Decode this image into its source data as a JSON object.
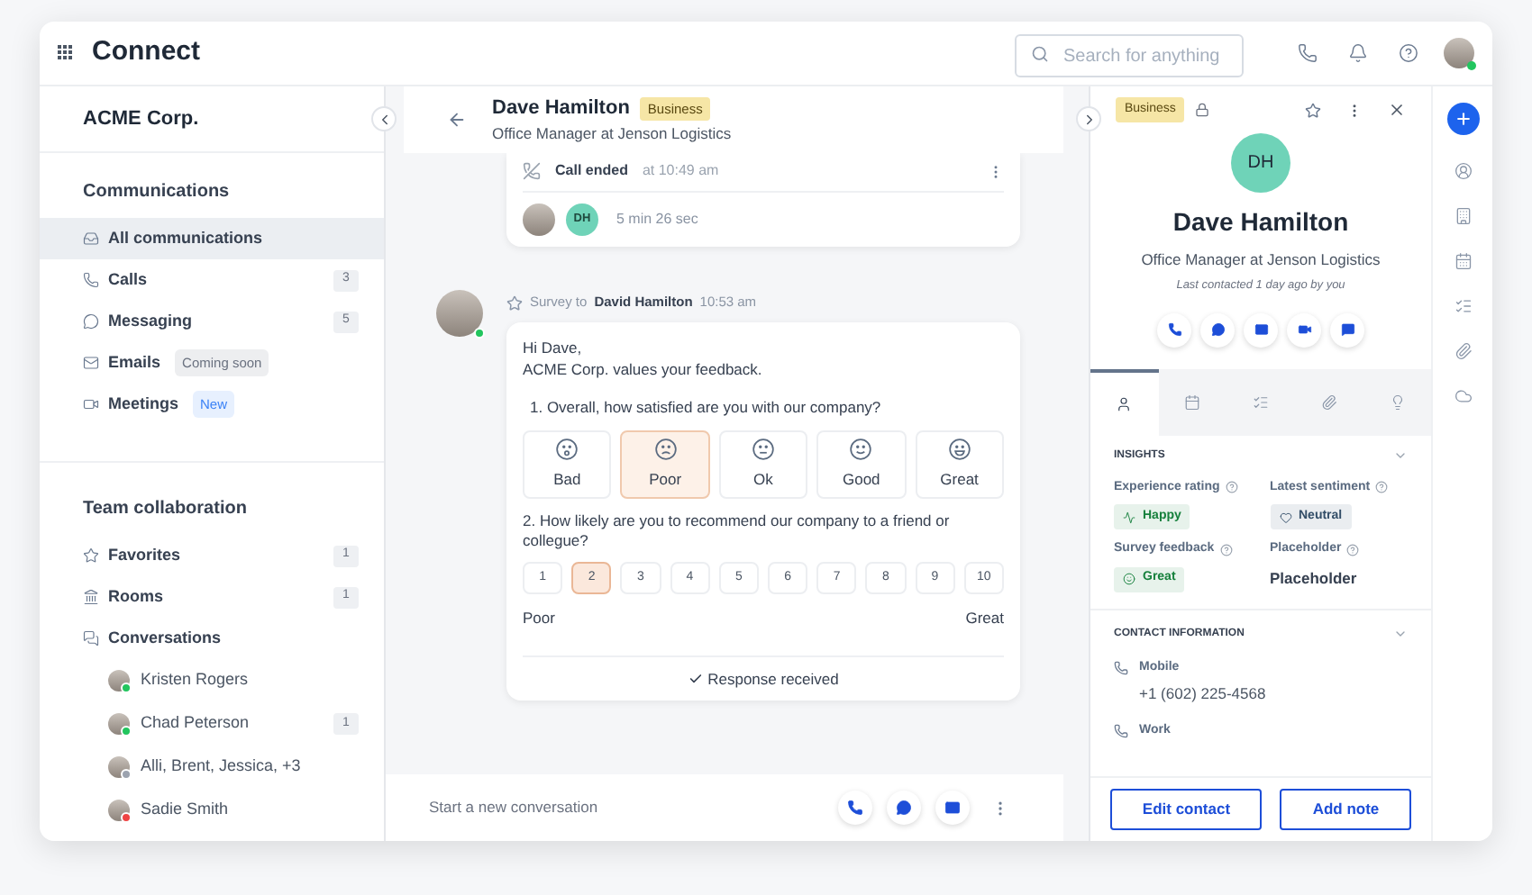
{
  "app": {
    "title": "Connect"
  },
  "search": {
    "placeholder": "Search for anything"
  },
  "sidebar": {
    "org": "ACME Corp.",
    "sections": [
      {
        "title": "Communications",
        "items": [
          {
            "label": "All communications",
            "selected": true
          },
          {
            "label": "Calls",
            "count": "3",
            "selected": false
          },
          {
            "label": "Messaging",
            "count": "5",
            "selected": false
          },
          {
            "label": "Emails",
            "badge": "Coming soon",
            "color": "#6b7280",
            "selected": false
          },
          {
            "label": "Meetings",
            "badge": "New",
            "color": "#3b82f6",
            "selected": false
          }
        ]
      },
      {
        "title": "Team collaboration",
        "items": [
          {
            "label": "Favorites",
            "count": "1",
            "selected": false
          },
          {
            "label": "Rooms",
            "count": "1",
            "selected": false
          },
          {
            "label": "Conversations",
            "selected": false
          }
        ]
      }
    ],
    "conversations": [
      {
        "name": "Kristen Rogers",
        "color": "#22c55e"
      },
      {
        "name": "Chad Peterson",
        "color": "#22c55e",
        "count": "1"
      },
      {
        "name": "Alli, Brent, Jessica, +3",
        "color": "#9ca3af"
      },
      {
        "name": "Sadie Smith",
        "color": "#ef4444"
      }
    ]
  },
  "conversation": {
    "name": "Dave Hamilton",
    "tag": "Business",
    "subtitle": "Office Manager at Jenson Logistics",
    "call": {
      "status": "Call ended",
      "time": "at 10:49 am",
      "duration": "5 min 26 sec",
      "participants": [
        {
          "kind": "photo"
        },
        {
          "kind": "initials",
          "initials": "DH"
        }
      ]
    },
    "survey": {
      "prefix": "Survey to",
      "recipient": "David Hamilton",
      "time": "10:53 am",
      "greeting": "Hi Dave,",
      "intro": "ACME Corp. values your feedback.",
      "q1": {
        "text": "1. Overall, how satisfied are you with our company?",
        "options": [
          {
            "label": "Bad",
            "selected": false
          },
          {
            "label": "Poor",
            "selected": true
          },
          {
            "label": "Ok",
            "selected": false
          },
          {
            "label": "Good",
            "selected": false
          },
          {
            "label": "Great",
            "selected": false
          }
        ]
      },
      "q2": {
        "text": "2. How likely are you to recommend our company to a friend or collegue?",
        "options": [
          {
            "label": "1",
            "selected": false
          },
          {
            "label": "2",
            "selected": true
          },
          {
            "label": "3",
            "selected": false
          },
          {
            "label": "4",
            "selected": false
          },
          {
            "label": "5",
            "selected": false
          },
          {
            "label": "6",
            "selected": false
          },
          {
            "label": "7",
            "selected": false
          },
          {
            "label": "8",
            "selected": false
          },
          {
            "label": "9",
            "selected": false
          },
          {
            "label": "10",
            "selected": false
          }
        ],
        "low": "Poor",
        "high": "Great"
      },
      "status": "Response received"
    },
    "composer": {
      "placeholder": "Start a new conversation"
    }
  },
  "contact": {
    "tag": "Business",
    "initials": "DH",
    "name": "Dave Hamilton",
    "title": "Office Manager at Jenson Logistics",
    "last_contacted": "Last contacted 1 day ago by you",
    "tabs": [
      {
        "selected": true
      },
      {
        "selected": false
      },
      {
        "selected": false
      },
      {
        "selected": false
      },
      {
        "selected": false
      }
    ],
    "insights": {
      "title": "INSIGHTS",
      "fields": [
        {
          "label": "Experience rating",
          "kind": "pill",
          "color": "#16803c",
          "value": "Happy"
        },
        {
          "label": "Latest sentiment",
          "kind": "pill",
          "color": "#334e68",
          "value": "Neutral"
        },
        {
          "label": "Survey feedback",
          "kind": "pill",
          "color": "#16803c",
          "value": "Great"
        },
        {
          "label": "Placeholder",
          "kind": "text",
          "value": "Placeholder"
        }
      ]
    },
    "contact_info": {
      "title": "CONTACT INFORMATION",
      "entries": [
        {
          "label": "Mobile",
          "value": "+1 (602) 225-4568"
        },
        {
          "label": "Work"
        }
      ]
    },
    "buttons": [
      "Edit contact",
      "Add note"
    ]
  }
}
